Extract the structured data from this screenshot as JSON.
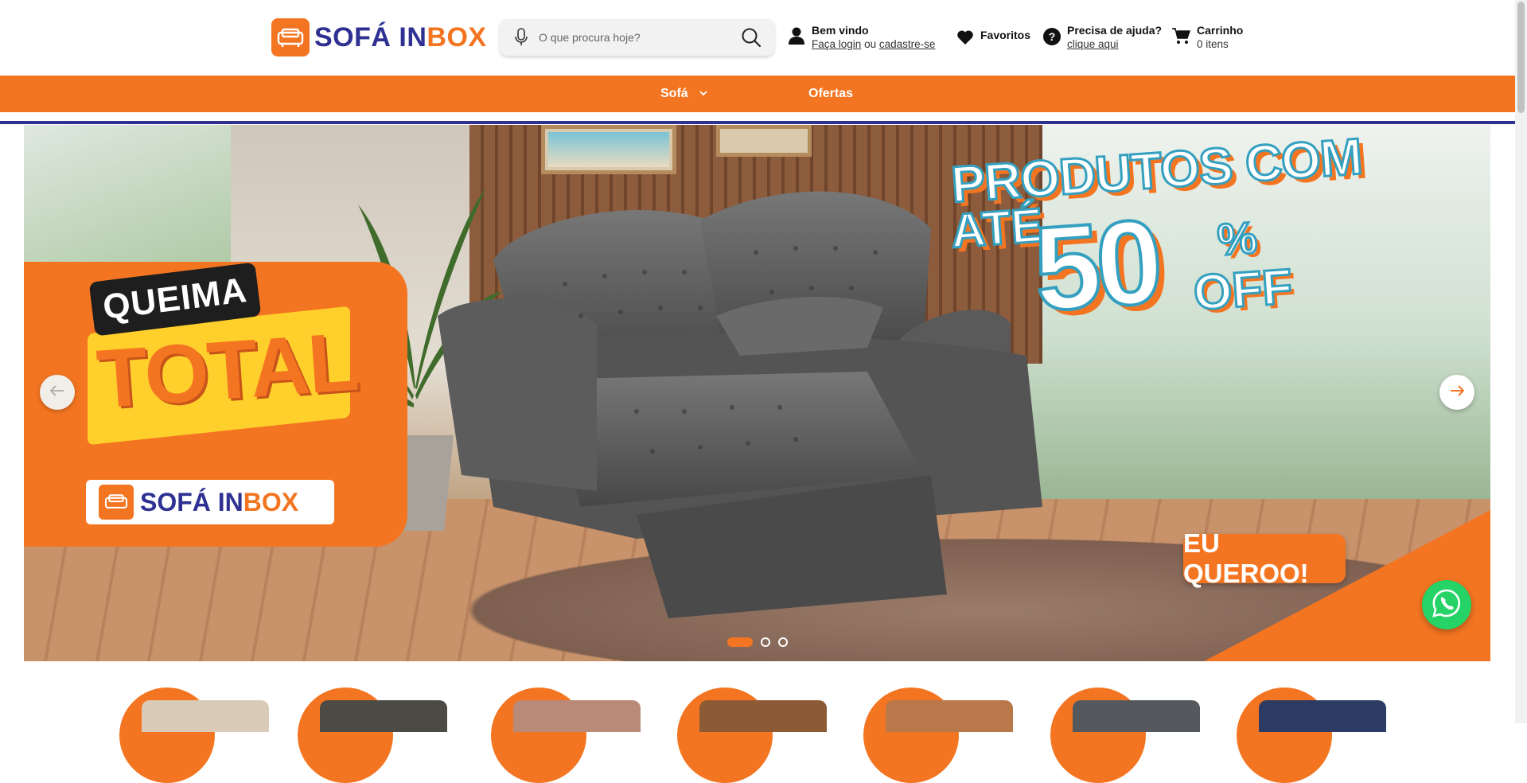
{
  "header": {
    "logo": {
      "part1": "SOFÁ IN",
      "part2": "BOX"
    },
    "search": {
      "placeholder": "O que procura hoje?"
    },
    "account": {
      "title": "Bem vindo",
      "login": "Faça login",
      "or": "ou",
      "signup": "cadastre-se"
    },
    "favorites": {
      "label": "Favoritos"
    },
    "help": {
      "title": "Precisa de ajuda?",
      "link": "clique aqui"
    },
    "cart": {
      "title": "Carrinho",
      "count": "0 itens"
    }
  },
  "nav": {
    "items": [
      {
        "label": "Sofá",
        "has_dropdown": true
      },
      {
        "label": "Ofertas",
        "has_dropdown": false
      }
    ]
  },
  "banner": {
    "queima": "QUEIMA",
    "total": "TOTAL",
    "brand_part1": "SOFÁ IN",
    "brand_part2": "BOX",
    "headline_1": "PRODUTOS COM",
    "headline_2": "ATÉ",
    "headline_50": "50",
    "headline_pct": "%",
    "headline_off": "OFF",
    "cta": "EU QUEROO!",
    "slides": 3,
    "active_slide": 1
  },
  "categories": [
    {
      "color": "#d9cbb8"
    },
    {
      "color": "#4b4a45"
    },
    {
      "color": "#b98a78"
    },
    {
      "color": "#8c5a34"
    },
    {
      "color": "#b9784a"
    },
    {
      "color": "#55595e"
    },
    {
      "color": "#2b3b63"
    }
  ],
  "colors": {
    "brand_orange": "#f47521",
    "brand_blue": "#2e3192",
    "whatsapp": "#25d366"
  }
}
